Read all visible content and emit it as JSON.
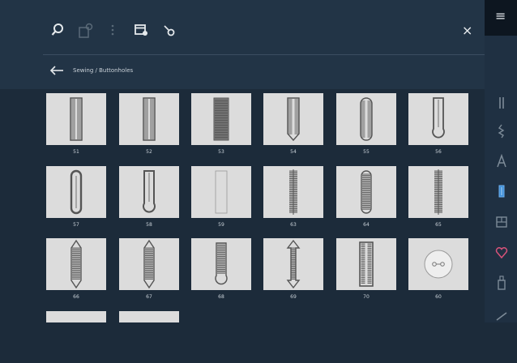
{
  "toolbar": {
    "icons": [
      "search-icon",
      "add-to-memory-icon",
      "more-icon",
      "file-info-icon",
      "bobbin-icon"
    ],
    "close_glyph": "×"
  },
  "breadcrumb": {
    "text": "Sewing / Buttonholes"
  },
  "menu_glyph": "≡",
  "colors": {
    "accent_selected": "#3f8fd8",
    "favorite_accent": "#d8537a"
  },
  "tiles": [
    {
      "label": "51",
      "style": "rect-double"
    },
    {
      "label": "52",
      "style": "rect-double"
    },
    {
      "label": "53",
      "style": "dense"
    },
    {
      "label": "54",
      "style": "zigzag-taper"
    },
    {
      "label": "55",
      "style": "rounded-zigzag"
    },
    {
      "label": "56",
      "style": "keyhole-plain"
    },
    {
      "label": "57",
      "style": "oval-plain"
    },
    {
      "label": "58",
      "style": "keyhole-round"
    },
    {
      "label": "59",
      "style": "outline"
    },
    {
      "label": "63",
      "style": "zigzag-thin"
    },
    {
      "label": "64",
      "style": "rounded-satin"
    },
    {
      "label": "65",
      "style": "zigzag-thin"
    },
    {
      "label": "66",
      "style": "pointed-satin"
    },
    {
      "label": "67",
      "style": "pointed-satin"
    },
    {
      "label": "68",
      "style": "keyhole-satin"
    },
    {
      "label": "69",
      "style": "arrow-satin"
    },
    {
      "label": "70",
      "style": "rect-satin"
    },
    {
      "label": "60",
      "style": "button"
    },
    {
      "label": "",
      "style": "partial"
    },
    {
      "label": "",
      "style": "partial"
    }
  ],
  "sidebar": {
    "items": [
      {
        "name": "practical-stitches-icon",
        "selected": false
      },
      {
        "name": "decorative-stitches-icon",
        "selected": false
      },
      {
        "name": "alphabets-icon",
        "selected": false
      },
      {
        "name": "buttonholes-icon",
        "selected": true
      },
      {
        "name": "quilt-stitches-icon",
        "selected": false
      },
      {
        "name": "favorites-icon",
        "selected": false
      },
      {
        "name": "memory-icon",
        "selected": false
      },
      {
        "name": "tutorial-icon",
        "selected": false
      }
    ]
  }
}
